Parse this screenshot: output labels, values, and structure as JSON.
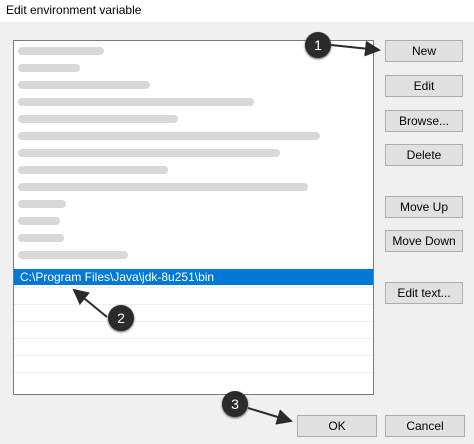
{
  "window": {
    "title": "Edit environment variable"
  },
  "list": {
    "selected_entry": "C:\\Program Files\\Java\\jdk-8u251\\bin"
  },
  "buttons": {
    "new": "New",
    "edit": "Edit",
    "browse": "Browse...",
    "delete": "Delete",
    "move_up": "Move Up",
    "move_down": "Move Down",
    "edit_text": "Edit text...",
    "ok": "OK",
    "cancel": "Cancel"
  },
  "markers": {
    "one": "1",
    "two": "2",
    "three": "3"
  },
  "colors": {
    "selection": "#0078d7",
    "marker": "#2b2b2b",
    "dialog_bg": "#f0f0f0"
  }
}
